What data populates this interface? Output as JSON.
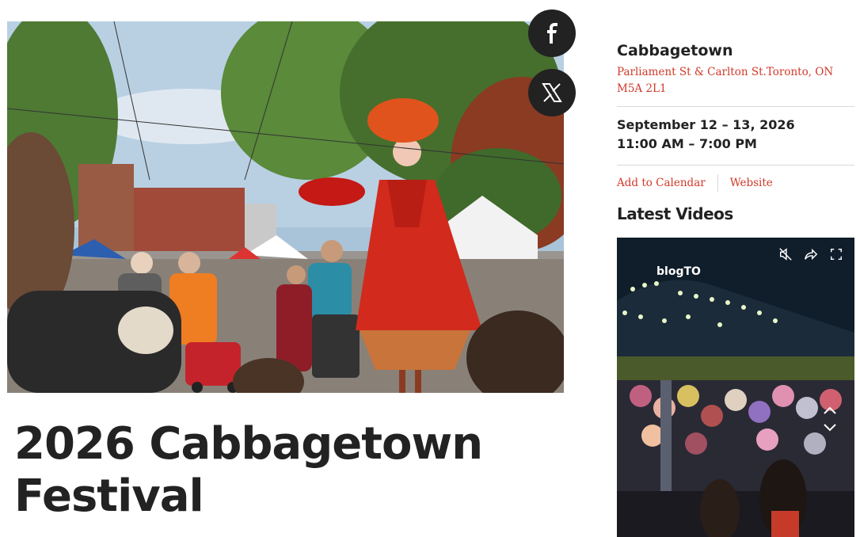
{
  "hero": {
    "alt_subject": "festival-photo"
  },
  "share": {
    "facebook_icon": "facebook-icon",
    "x_icon": "x-icon"
  },
  "event": {
    "title": "2026 Cabbagetown Festival"
  },
  "venue": {
    "name": "Cabbagetown",
    "address": "Parliament St & Carlton St.Toronto, ON M5A 2L1"
  },
  "dates": {
    "date_range": "September 12 – 13, 2026",
    "time_range": "11:00 AM – 7:00 PM"
  },
  "links": {
    "add_to_calendar": "Add to Calendar",
    "website": "Website"
  },
  "videos": {
    "section_title": "Latest Videos",
    "channel_logo": "blogTO",
    "controls": [
      "mute-icon",
      "share-icon",
      "fullscreen-icon"
    ]
  },
  "colors": {
    "accent": "#d03a2a",
    "text": "#222222",
    "button_bg": "#222222"
  }
}
